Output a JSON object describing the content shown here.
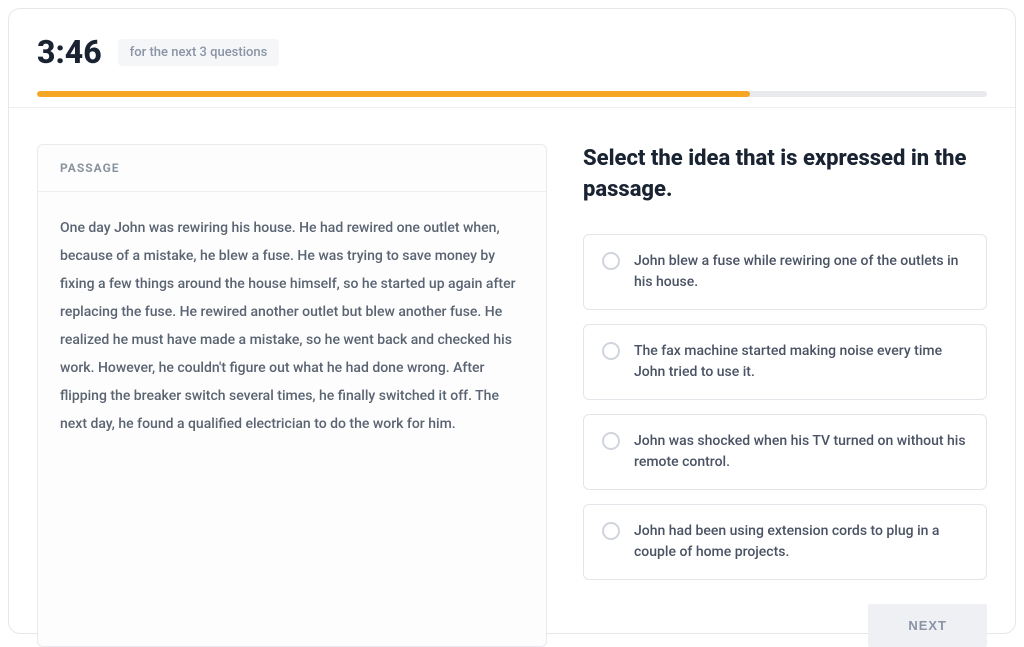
{
  "timer": {
    "value": "3:46",
    "label": "for the next 3 questions"
  },
  "progress": {
    "percent": 75
  },
  "passage": {
    "label": "PASSAGE",
    "text": "One day John was rewiring his house. He had rewired one outlet when, because of a mistake, he blew a fuse. He was trying to save money by fixing a few things around the house himself, so he started up again after replacing the fuse. He rewired another outlet but blew another fuse. He realized he must have made a mistake, so he went back and checked his work. However, he couldn't figure out what he had done wrong. After flipping the breaker switch several times, he finally switched it off. The next day, he found a qualified electrician to do the work for him."
  },
  "question": {
    "title": "Select the idea that is expressed in the passage.",
    "options": [
      "John blew a fuse while rewiring one of the outlets in his house.",
      "The fax machine started making noise every time John tried to use it.",
      "John was shocked when his TV turned on without his remote control.",
      "John had been using extension cords to plug in a couple of home projects."
    ]
  },
  "footer": {
    "next_label": "NEXT"
  }
}
